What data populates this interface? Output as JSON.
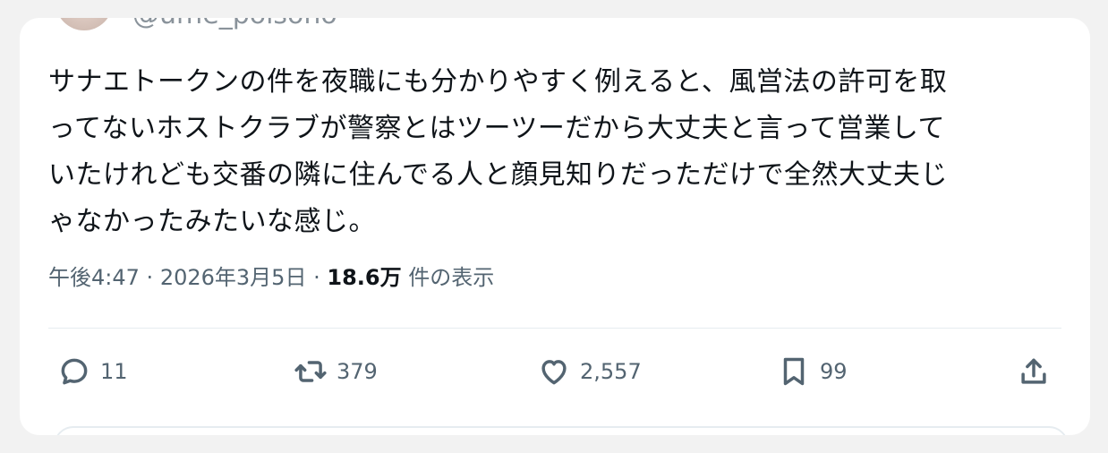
{
  "author": {
    "handle": "@ume_poisono"
  },
  "tweet": {
    "lines": [
      "サナエトークンの件を夜職にも分かりやすく例えると、風営法の許可を取",
      "ってないホストクラブが警察とはツーツーだから大丈夫と言って営業して",
      "いたけれども交番の隣に住んでる人と顔見知りだっただけで全然大丈夫じ",
      "ゃなかったみたいな感じ。"
    ]
  },
  "meta": {
    "time": "午後4:47",
    "separator": "·",
    "date": "2026年3月5日",
    "views_count": "18.6万",
    "views_label": "件の表示"
  },
  "actions": {
    "reply_count": "11",
    "retweet_count": "379",
    "like_count": "2,557",
    "bookmark_count": "99"
  },
  "icons": {
    "reply": "reply-icon",
    "retweet": "retweet-icon",
    "like": "heart-icon",
    "bookmark": "bookmark-icon",
    "share": "share-icon"
  },
  "colors": {
    "text": "#0f1419",
    "secondary": "#536471",
    "background": "#ffffff"
  }
}
